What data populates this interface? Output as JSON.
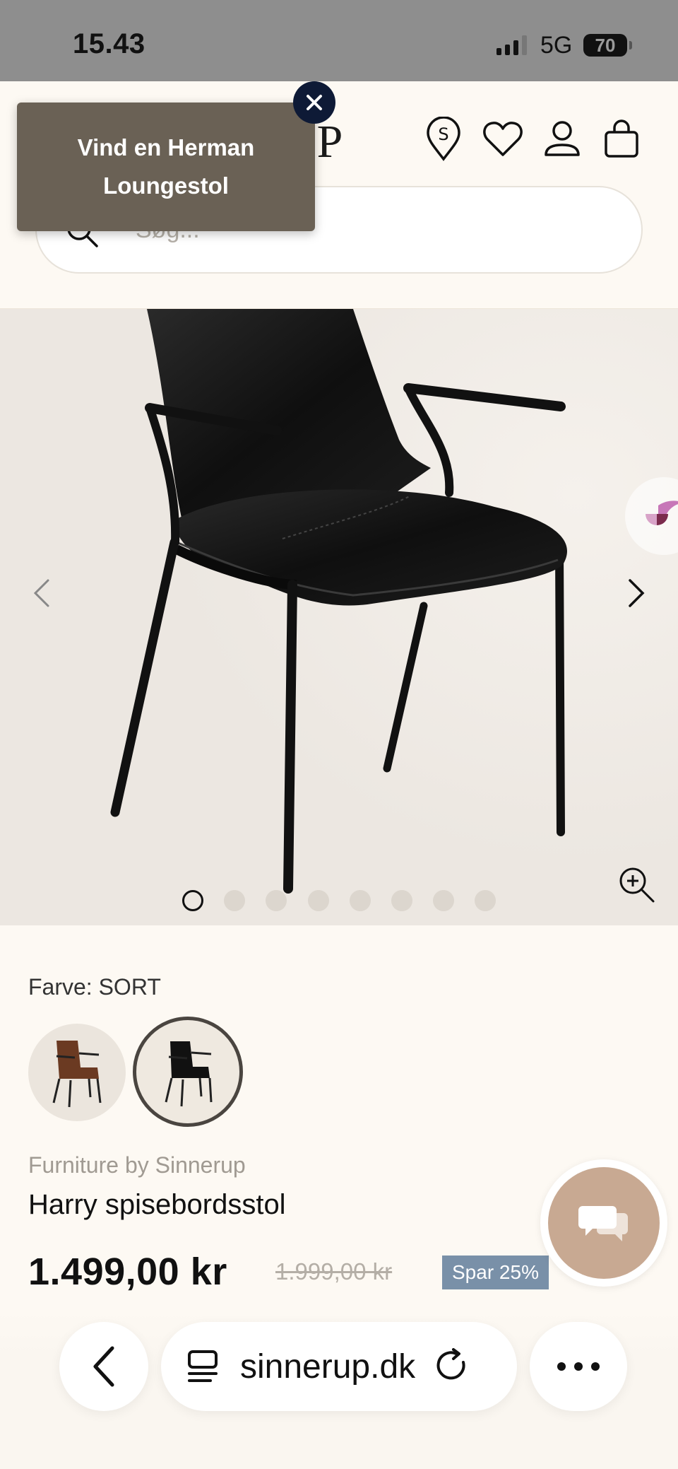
{
  "status_bar": {
    "time": "15.43",
    "network": "5G",
    "battery": "70"
  },
  "header": {
    "logo_partial": "UP"
  },
  "search": {
    "placeholder": "Søg..."
  },
  "popup": {
    "text": "Vind en Herman Loungestol"
  },
  "gallery": {
    "total_images": 8,
    "active_index": 0
  },
  "product": {
    "color_label": "Farve: SORT",
    "swatches": [
      {
        "name": "brown",
        "color": "#6b3a22",
        "selected": false
      },
      {
        "name": "black",
        "color": "#111111",
        "selected": true
      }
    ],
    "brand": "Furniture by Sinnerup",
    "name": "Harry spisebordsstol",
    "price": "1.499,00 kr",
    "old_price": "1.999,00 kr",
    "save_badge": "Spar 25%"
  },
  "browser": {
    "url": "sinnerup.dk"
  },
  "colors": {
    "header_bg": "#fdf9f3",
    "popup_bg": "#6a6155",
    "close_bg": "#0e1a36",
    "chat_btn": "#c8a992",
    "badge": "#7990a8"
  }
}
